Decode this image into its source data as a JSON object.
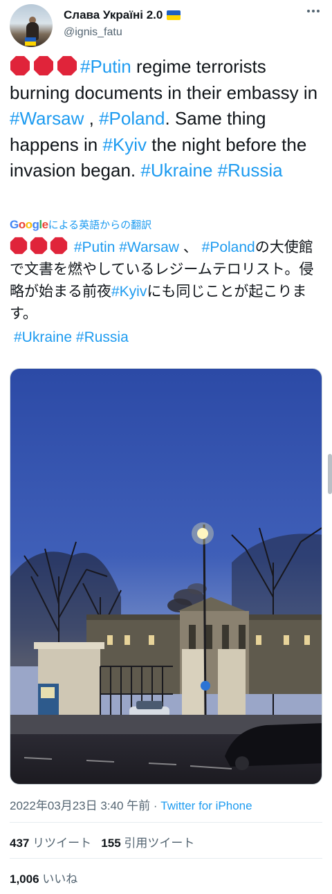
{
  "author": {
    "display_name": "Слава Україні 2.0",
    "handle": "@ignis_fatu"
  },
  "tweet": {
    "line1_rest": " regime terrorists burning documents in their embassy in ",
    "tag_putin": "#Putin",
    "tag_warsaw": "#Warsaw",
    "sep1": " , ",
    "tag_poland": "#Poland",
    "sep2": ". Same thing happens in ",
    "tag_kyiv": "#Kyiv",
    "sep3": " the night before the invasion began. ",
    "tag_ukraine": "#Ukraine",
    "tag_russia": "#Russia"
  },
  "translation": {
    "google_label": "Google",
    "label": "による英語からの翻訳",
    "tag_putin": "#Putin",
    "tag_warsaw": "#Warsaw",
    "sep1": " 、 ",
    "tag_poland": "#Poland",
    "text1": "の大使館で文書を燃やしているレジームテロリスト。侵略が始まる前夜",
    "tag_kyiv": "#Kyiv",
    "text2": "にも同じことが起こります。",
    "tag_ukraine": "#Ukraine",
    "tag_russia": "#Russia"
  },
  "meta": {
    "timestamp": "2022年03月23日 3:40 午前",
    "dot": " · ",
    "source": "Twitter for iPhone"
  },
  "stats": {
    "retweets": "437",
    "retweets_label": " リツイート",
    "quotes": "155",
    "quotes_label": " 引用ツイート",
    "likes": "1,006",
    "likes_label": " いいね"
  },
  "colors": {
    "link": "#1d9bf0",
    "text": "#0f1419",
    "muted": "#536471",
    "stop_sign": "#e0243a"
  },
  "icons": [
    "stop-sign-emoji",
    "ukraine-flag-emoji",
    "more-options-icon"
  ]
}
